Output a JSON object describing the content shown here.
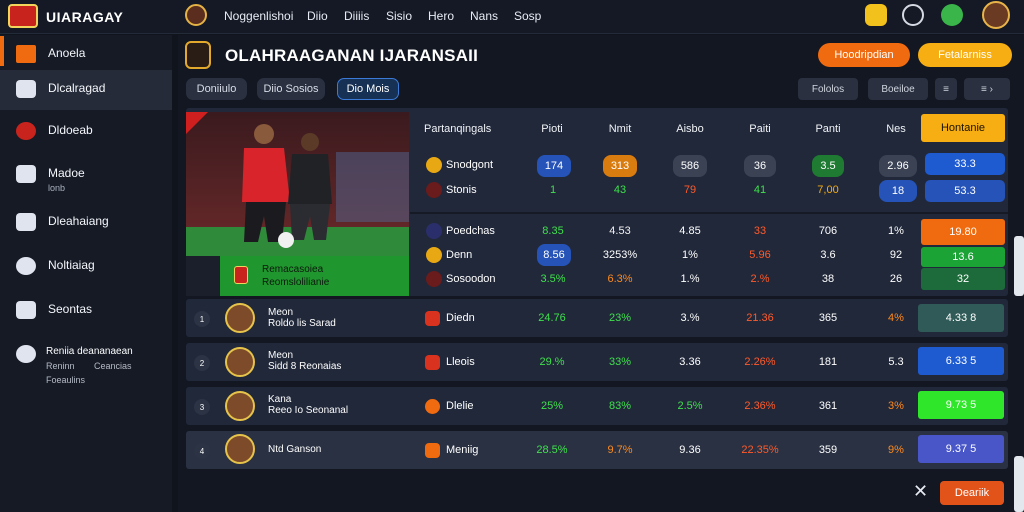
{
  "app": {
    "brand": "UIARAGAY"
  },
  "nav": [
    "Noggenlishoi",
    "Diio",
    "Diiiis",
    "Sisio",
    "Hero",
    "Nans",
    "Sosp"
  ],
  "topicons": [
    "trophy-icon",
    "settings-icon",
    "notification-icon",
    "avatar"
  ],
  "sidebar": [
    {
      "label": "Anoela",
      "icon": "home-icon"
    },
    {
      "label": "Dlcalragad",
      "icon": "chart-icon"
    },
    {
      "label": "Dldoeab",
      "icon": "shield-icon"
    },
    {
      "label": "Madoe",
      "icon": "bag-icon",
      "sub": "lonb"
    },
    {
      "label": "Dleahaiang",
      "icon": "calendar-icon"
    },
    {
      "label": "Noltiaiag",
      "icon": "bell-icon"
    },
    {
      "label": "Seontas",
      "icon": "monitor-icon"
    },
    {
      "label": "Reniia deananaean",
      "icon": "gear-icon",
      "sub": "Reninn",
      "sub2": "Ceancias",
      "sub3": "Foeaulins"
    }
  ],
  "page": {
    "title": "OLAHRAAGANAN IJARANSAII",
    "actions": [
      "Hoodripdian",
      "Fetalarniss"
    ],
    "tabs": [
      "Doniiulo",
      "Diio Sosios",
      "Dio Mois"
    ],
    "tools": [
      "Fololos",
      "Boeiloe"
    ]
  },
  "hero": {
    "caption_a": "Remacasoiea",
    "caption_b": "Reomslolilianie"
  },
  "columns": [
    "Partanqingals",
    "Pioti",
    "Nmit",
    "Aisbo",
    "Paiti",
    "Panti",
    "Nes",
    "Hontanie"
  ],
  "panel_rows": [
    {
      "name": "Snodgont",
      "values": [
        "174",
        "313",
        "586",
        "36",
        "3.5",
        "2.96",
        "33.3"
      ]
    },
    {
      "name": "Stonis",
      "values": [
        "1",
        "43",
        "79",
        "41",
        "7,00",
        "18",
        "53.3"
      ]
    },
    {
      "name": "Poedchas",
      "values": [
        "8.35",
        "4.53",
        "4.85",
        "33",
        "706",
        "1%",
        "19.80"
      ]
    },
    {
      "name": "Denn",
      "values": [
        "8.56",
        "3253%",
        "1%",
        "5.96",
        "3.6",
        "92",
        "13.6"
      ]
    },
    {
      "name": "Sosoodon",
      "values": [
        "3.5%",
        "6.3%",
        "1.%",
        "2.%",
        "38",
        "26",
        "32"
      ]
    }
  ],
  "rows": [
    {
      "num": "1",
      "player": "Meon",
      "team": "Roldo lis Sarad",
      "club": "Diedn",
      "values": [
        "24.76",
        "23%",
        "3.%",
        "21.36",
        "365",
        "4%",
        "4.33 8"
      ]
    },
    {
      "num": "2",
      "player": "Meon",
      "team": "Sidd 8 Reonaias",
      "club": "Lleois",
      "values": [
        "29.%",
        "33%",
        "3.36",
        "2.26%",
        "181",
        "5.3",
        "6.33 5"
      ]
    },
    {
      "num": "3",
      "player": "Kana",
      "team": "Reeo Io Seonanal",
      "club": "Dlelie",
      "values": [
        "25%",
        "83%",
        "2.5%",
        "2.36%",
        "361",
        "3%",
        "9.73 5"
      ]
    },
    {
      "num": "4",
      "player": "",
      "team": "Ntd Ganson",
      "club": "Meniig",
      "values": [
        "28.5%",
        "9.7%",
        "9.36",
        "22.35%",
        "359",
        "9%",
        "9.37 5"
      ]
    }
  ],
  "footer": {
    "button": "Deariik"
  },
  "colors": {
    "orange": "#f06b10",
    "yellow": "#f6ae12",
    "green": "#26c83a",
    "blue": "#1e5bd0"
  }
}
